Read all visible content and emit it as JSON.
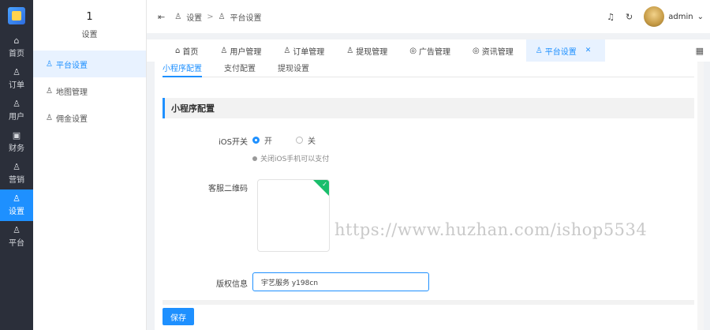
{
  "rail": {
    "items": [
      {
        "label": "首页",
        "icon": "⌂"
      },
      {
        "label": "订单",
        "icon": "♙"
      },
      {
        "label": "用户",
        "icon": "♙"
      },
      {
        "label": "财务",
        "icon": "▣"
      },
      {
        "label": "营销",
        "icon": "♙"
      },
      {
        "label": "设置",
        "icon": "♙"
      },
      {
        "label": "平台",
        "icon": "♙"
      }
    ]
  },
  "submenu": {
    "count": "1",
    "title": "设置",
    "items": [
      "平台设置",
      "地图管理",
      "佣金设置"
    ]
  },
  "header": {
    "fold_icon": "⇤",
    "breadcrumb": [
      "设置",
      "平台设置"
    ],
    "breadcrumb_sep": ">",
    "user": "admin"
  },
  "tabs": [
    "首页",
    "用户管理",
    "订单管理",
    "提现管理",
    "广告管理",
    "资讯管理",
    "平台设置"
  ],
  "subtabs": [
    "小程序配置",
    "支付配置",
    "提现设置"
  ],
  "section_title": "小程序配置",
  "ios_switch": {
    "label": "iOS开关",
    "options": [
      "开",
      "关"
    ],
    "selected": "开",
    "hint": "关闭iOS手机可以支付"
  },
  "qr": {
    "label": "客服二维码"
  },
  "copyright": {
    "label": "版权信息",
    "value": "宇艺服务 y198cn"
  },
  "watermark": "https://www.huzhan.com/ishop5534",
  "save_label": "保存",
  "colors": {
    "accent": "#1e90ff",
    "rail_bg": "#2b2f3a",
    "success": "#19be6b"
  }
}
